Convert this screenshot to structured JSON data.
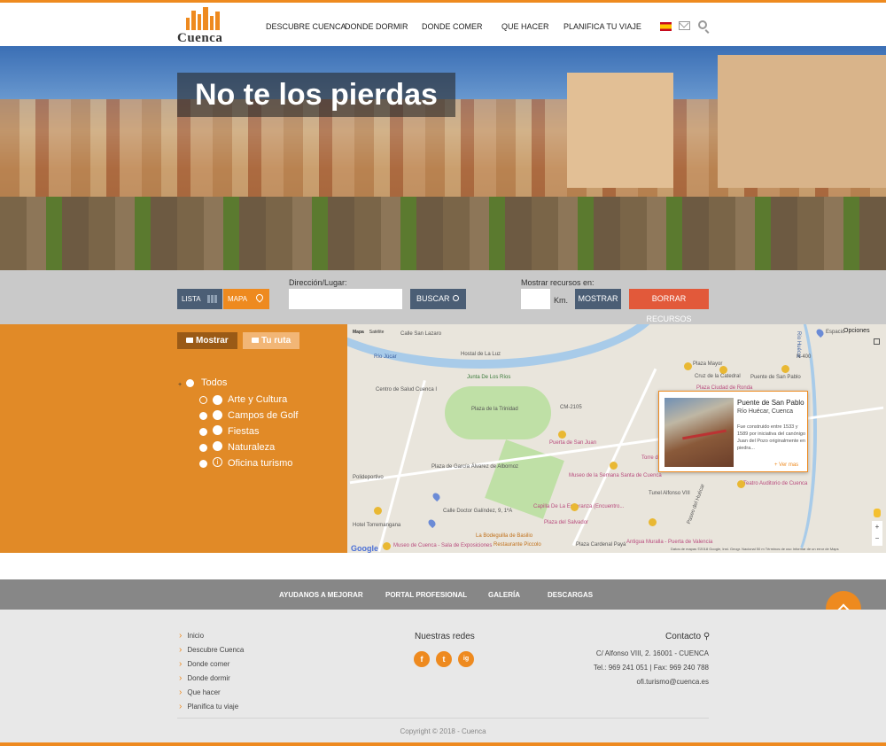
{
  "header": {
    "logo_text": "Cuenca",
    "nav": [
      "DESCUBRE CUENCA",
      "DONDE DORMIR",
      "DONDE COMER",
      "QUE HACER",
      "PLANIFICA TU VIAJE"
    ],
    "icons": [
      "spain-flag-icon",
      "mail-icon",
      "search-icon"
    ]
  },
  "hero": {
    "title": "No te los pierdas"
  },
  "filters": {
    "lista_label": "LISTA",
    "mapa_label": "MAPA",
    "direccion_label": "Dirección/Lugar:",
    "direccion_value": "",
    "buscar_label": "BUSCAR",
    "recursos_label": "Mostrar recursos en:",
    "km_value": "",
    "km_label": "Km.",
    "mostrar_label": "MOSTRAR",
    "borrar_label": "BORRAR RECURSOS"
  },
  "sidebar": {
    "tab_mostrar": "Mostrar",
    "tab_ruta": "Tu ruta",
    "root_label": "Todos",
    "categories": [
      "Arte y Cultura",
      "Campos de Golf",
      "Fiestas",
      "Naturaleza",
      "Oficina turismo"
    ]
  },
  "map": {
    "type_map": "Mapa",
    "type_sat": "Satélite",
    "opciones": "Opciones",
    "labels": {
      "calle_san_lazaro": "Calle San Lazaro",
      "rio_jucar": "Río Júcar",
      "hostal_luz": "Hostal de La Luz",
      "centro_salud": "Centro de Salud Cuenca I",
      "junta_rios": "Junta De Los Ríos",
      "plaza_trinidad": "Plaza de la Trinidad",
      "plaza_mayor": "Plaza Mayor",
      "cruz_catedral": "Cruz de la Catedral",
      "puente_san_pablo": "Puente de San Pablo",
      "plaza_ciudad_ronda": "Plaza Ciudad de Ronda",
      "rio_huecar": "Río Huécar",
      "espacio": "Espacio",
      "puerta_san_juan": "Puerta de San Juan",
      "torre_mangana": "Torre de Mangana",
      "teatro_auditorio": "Teatro Auditorio de Cuenca",
      "museo_semana_santa": "Museo de la Semana Santa de Cuenca",
      "plaza_garcia": "Plaza de García Álvarez de Albornoz",
      "capilla_esperanza": "Capilla De La Esperanza (Encuentro...",
      "calle_doctor": "Calle Doctor Galíndez, 9, 1ºA",
      "hotel_torremangana": "Hotel Torremangana",
      "plaza_salvador": "Plaza del Salvador",
      "bodeguilla_basilio": "La Bodeguilla de Basilio",
      "museo_exposiciones": "Museo de Cuenca - Sala de Exposiciones",
      "restaurante_piccolo": "Restaurante Piccolo",
      "plaza_cardenal": "Plaza Cardenal Payá",
      "antigua_muralla": "Antigua Muralla - Puerta de Valencia",
      "tunel_alfonso": "Tunel Alfonso VIII",
      "polideportivo": "Polideportivo",
      "cm2105": "CM-2105",
      "n400": "N-400",
      "paseo_huecar": "Paseo del Huécar"
    },
    "footer": "Datos de mapas ©2018 Google, Inst. Geogr. Nacional   50 m   Términos de uso   Informar de un error de Maps",
    "google": "Google",
    "popup": {
      "title": "Puente de San Pablo",
      "subtitle": "Río Huécar, Cuenca",
      "description": "Fue construido entre 1533 y 1589 por iniciativa del canónigo Juan del Pozo originalmente en piedra...",
      "more": "+ Ver mas"
    }
  },
  "footer_nav": [
    "AYUDANOS A MEJORAR",
    "PORTAL PROFESIONAL",
    "GALERÍA",
    "DESCARGAS"
  ],
  "footer": {
    "links": [
      "Inicio",
      "Descubre Cuenca",
      "Donde comer",
      "Donde dormir",
      "Que hacer",
      "Planifica tu viaje"
    ],
    "redes_title": "Nuestras redes",
    "social": [
      "f",
      "t",
      "ig"
    ],
    "contacto_title": "Contacto",
    "address": "C/ Alfonso VIII, 2. 16001 - CUENCA",
    "phone": "Tel.: 969 241 051 | Fax: 969 240 788",
    "email": "ofi.turismo@cuenca.es",
    "copyright": "Copyright © 2018 - Cuenca"
  },
  "colors": {
    "accent": "#ee8a1f",
    "dark_button": "#4b5e75",
    "danger": "#e2593a",
    "footer_nav": "#878787"
  }
}
